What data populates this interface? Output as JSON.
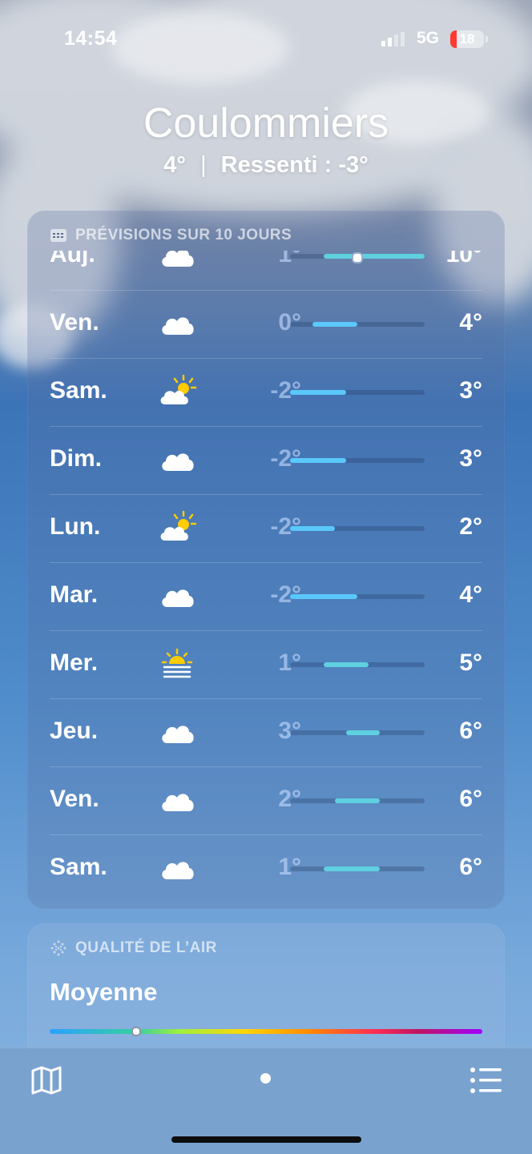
{
  "status": {
    "time": "14:54",
    "network": "5G",
    "battery": "18"
  },
  "header": {
    "city": "Coulommiers",
    "current": "4°",
    "separator": "|",
    "feels_like": "Ressenti : -3°"
  },
  "forecast": {
    "title": "PRÉVISIONS SUR 10 JOURS",
    "icon": "calendar-icon",
    "range_min": -2,
    "range_max": 10,
    "rows": [
      {
        "day": "Auj.",
        "icon": "cloud-icon",
        "low": "1°",
        "high": "10°",
        "low_val": 1,
        "high_val": 10,
        "current_val": 4
      },
      {
        "day": "Ven.",
        "icon": "cloud-icon",
        "low": "0°",
        "high": "4°",
        "low_val": 0,
        "high_val": 4
      },
      {
        "day": "Sam.",
        "icon": "partly-sunny-icon",
        "low": "-2°",
        "high": "3°",
        "low_val": -2,
        "high_val": 3
      },
      {
        "day": "Dim.",
        "icon": "cloud-icon",
        "low": "-2°",
        "high": "3°",
        "low_val": -2,
        "high_val": 3
      },
      {
        "day": "Lun.",
        "icon": "partly-sunny-icon",
        "low": "-2°",
        "high": "2°",
        "low_val": -2,
        "high_val": 2
      },
      {
        "day": "Mar.",
        "icon": "cloud-icon",
        "low": "-2°",
        "high": "4°",
        "low_val": -2,
        "high_val": 4
      },
      {
        "day": "Mer.",
        "icon": "fog-sun-icon",
        "low": "1°",
        "high": "5°",
        "low_val": 1,
        "high_val": 5
      },
      {
        "day": "Jeu.",
        "icon": "cloud-icon",
        "low": "3°",
        "high": "6°",
        "low_val": 3,
        "high_val": 6
      },
      {
        "day": "Ven.",
        "icon": "cloud-icon",
        "low": "2°",
        "high": "6°",
        "low_val": 2,
        "high_val": 6
      },
      {
        "day": "Sam.",
        "icon": "cloud-icon",
        "low": "1°",
        "high": "6°",
        "low_val": 1,
        "high_val": 6
      }
    ]
  },
  "air_quality": {
    "title": "QUALITÉ DE L’AIR",
    "icon": "air-quality-icon",
    "value": "Moyenne",
    "level_fraction": 0.2
  },
  "bottom_bar": {
    "map_icon": "map-icon",
    "page_indicator": "page-dot",
    "list_icon": "list-icon"
  },
  "colors": {
    "bar_cold": "#5ac8fa",
    "bar_cool": "#5fd0e0",
    "sun": "#ffcc00"
  }
}
